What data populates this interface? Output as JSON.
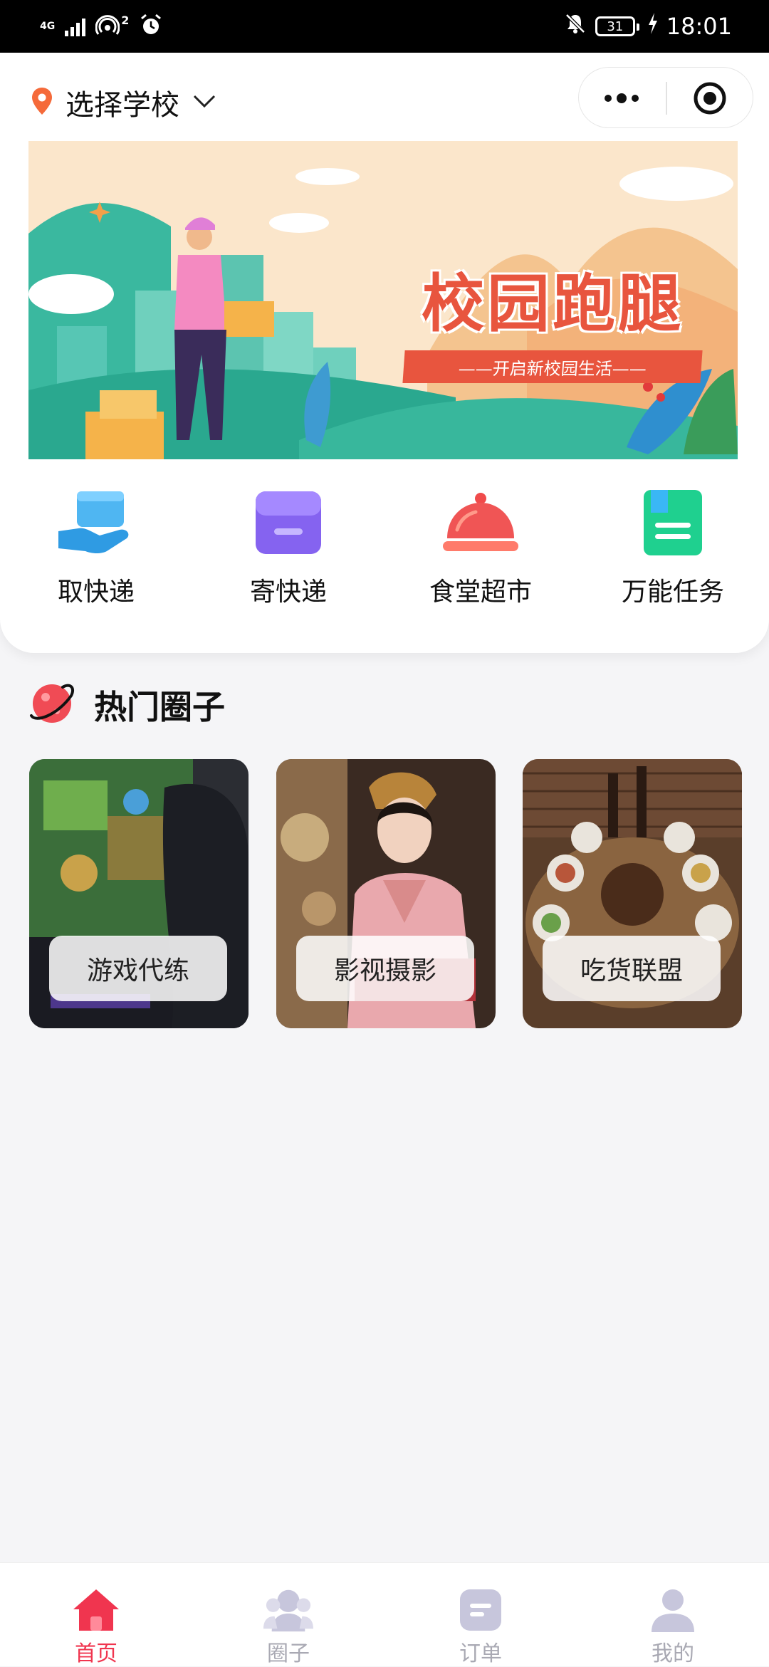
{
  "status_bar": {
    "network": "4G",
    "time": "18:01",
    "battery": "31",
    "hotspot_count": "2"
  },
  "header": {
    "location_label": "选择学校"
  },
  "banner": {
    "title": "校园跑腿",
    "subtitle": "——开启新校园生活——"
  },
  "services": [
    {
      "label": "取快递",
      "icon": "parcel-hand-icon"
    },
    {
      "label": "寄快递",
      "icon": "box-icon"
    },
    {
      "label": "食堂超市",
      "icon": "food-cloche-icon"
    },
    {
      "label": "万能任务",
      "icon": "task-note-icon"
    }
  ],
  "hot_circles": {
    "title": "热门圈子",
    "items": [
      {
        "label": "游戏代练"
      },
      {
        "label": "影视摄影"
      },
      {
        "label": "吃货联盟"
      }
    ]
  },
  "tabbar": {
    "active_color": "#f0354f",
    "items": [
      {
        "label": "首页",
        "icon": "home-icon",
        "active": true
      },
      {
        "label": "圈子",
        "icon": "people-icon",
        "active": false
      },
      {
        "label": "订单",
        "icon": "order-icon",
        "active": false
      },
      {
        "label": "我的",
        "icon": "profile-icon",
        "active": false
      }
    ]
  }
}
